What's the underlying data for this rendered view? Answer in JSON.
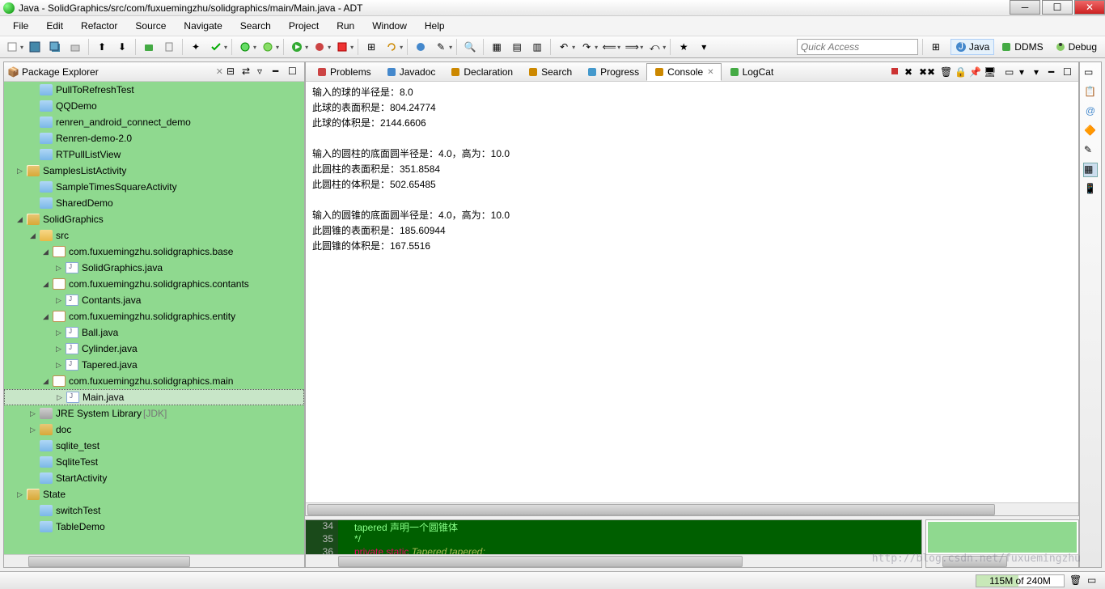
{
  "title": "Java - SolidGraphics/src/com/fuxuemingzhu/solidgraphics/main/Main.java - ADT",
  "menu": [
    "File",
    "Edit",
    "Refactor",
    "Source",
    "Navigate",
    "Search",
    "Project",
    "Run",
    "Window",
    "Help"
  ],
  "quick_access_placeholder": "Quick Access",
  "perspectives": [
    {
      "label": "Java",
      "icon": "java-persp"
    },
    {
      "label": "DDMS",
      "icon": "ddms"
    },
    {
      "label": "Debug",
      "icon": "debug"
    }
  ],
  "package_explorer": {
    "title": "Package Explorer",
    "items": [
      {
        "indent": 2,
        "twisty": "",
        "icon": "folder",
        "label": "PullToRefreshTest"
      },
      {
        "indent": 2,
        "twisty": "",
        "icon": "folder",
        "label": "QQDemo"
      },
      {
        "indent": 2,
        "twisty": "",
        "icon": "folder",
        "label": "renren_android_connect_demo"
      },
      {
        "indent": 2,
        "twisty": "",
        "icon": "folder",
        "label": "Renren-demo-2.0"
      },
      {
        "indent": 2,
        "twisty": "",
        "icon": "folder",
        "label": "RTPullListView"
      },
      {
        "indent": 1,
        "twisty": "▷",
        "icon": "proj",
        "label": "SamplesListActivity"
      },
      {
        "indent": 2,
        "twisty": "",
        "icon": "folder",
        "label": "SampleTimesSquareActivity"
      },
      {
        "indent": 2,
        "twisty": "",
        "icon": "folder",
        "label": "SharedDemo"
      },
      {
        "indent": 1,
        "twisty": "◢",
        "icon": "proj",
        "label": "SolidGraphics"
      },
      {
        "indent": 2,
        "twisty": "◢",
        "icon": "src",
        "label": "src"
      },
      {
        "indent": 3,
        "twisty": "◢",
        "icon": "pkg",
        "label": "com.fuxuemingzhu.solidgraphics.base"
      },
      {
        "indent": 4,
        "twisty": "▷",
        "icon": "java",
        "label": "SolidGraphics.java"
      },
      {
        "indent": 3,
        "twisty": "◢",
        "icon": "pkg",
        "label": "com.fuxuemingzhu.solidgraphics.contants"
      },
      {
        "indent": 4,
        "twisty": "▷",
        "icon": "java",
        "label": "Contants.java"
      },
      {
        "indent": 3,
        "twisty": "◢",
        "icon": "pkg",
        "label": "com.fuxuemingzhu.solidgraphics.entity"
      },
      {
        "indent": 4,
        "twisty": "▷",
        "icon": "java",
        "label": "Ball.java"
      },
      {
        "indent": 4,
        "twisty": "▷",
        "icon": "java",
        "label": "Cylinder.java"
      },
      {
        "indent": 4,
        "twisty": "▷",
        "icon": "java",
        "label": "Tapered.java"
      },
      {
        "indent": 3,
        "twisty": "◢",
        "icon": "pkg",
        "label": "com.fuxuemingzhu.solidgraphics.main"
      },
      {
        "indent": 4,
        "twisty": "▷",
        "icon": "java",
        "label": "Main.java",
        "selected": true
      },
      {
        "indent": 2,
        "twisty": "▷",
        "icon": "lib",
        "label": "JRE System Library",
        "suffix": "[JDK]"
      },
      {
        "indent": 2,
        "twisty": "▷",
        "icon": "folder-open",
        "label": "doc"
      },
      {
        "indent": 2,
        "twisty": "",
        "icon": "folder",
        "label": "sqlite_test"
      },
      {
        "indent": 2,
        "twisty": "",
        "icon": "folder",
        "label": "SqliteTest"
      },
      {
        "indent": 2,
        "twisty": "",
        "icon": "folder",
        "label": "StartActivity"
      },
      {
        "indent": 1,
        "twisty": "▷",
        "icon": "proj",
        "label": "State"
      },
      {
        "indent": 2,
        "twisty": "",
        "icon": "folder",
        "label": "switchTest"
      },
      {
        "indent": 2,
        "twisty": "",
        "icon": "folder",
        "label": "TableDemo"
      }
    ]
  },
  "tabs": [
    {
      "label": "Problems",
      "icon": "problems"
    },
    {
      "label": "Javadoc",
      "icon": "javadoc"
    },
    {
      "label": "Declaration",
      "icon": "declaration"
    },
    {
      "label": "Search",
      "icon": "search"
    },
    {
      "label": "Progress",
      "icon": "progress"
    },
    {
      "label": "Console",
      "icon": "console",
      "active": true,
      "closable": true
    },
    {
      "label": "LogCat",
      "icon": "logcat"
    }
  ],
  "console_output": [
    "输入的球的半径是：8.0",
    "此球的表面积是：804.24774",
    "此球的体积是：2144.6606",
    "",
    "输入的圆柱的底面圆半径是：4.0，高为：10.0",
    "此圆柱的表面积是：351.8584",
    "此圆柱的体积是：502.65485",
    "",
    "输入的圆锥的底面圆半径是：4.0，高为：10.0",
    "此圆锥的表面积是：185.60944",
    "此圆锥的体积是：167.5516"
  ],
  "code_snippet": [
    {
      "num": "34",
      "tokens": [
        {
          "t": "         tapered  声明一个圆锥体",
          "c": "cmt"
        }
      ]
    },
    {
      "num": "35",
      "tokens": [
        {
          "t": "     */",
          "c": "cmt"
        }
      ]
    },
    {
      "num": "36",
      "tokens": [
        {
          "t": "    private static ",
          "c": "kw"
        },
        {
          "t": "Tapered ",
          "c": "cls"
        },
        {
          "t": "tapered;",
          "c": "cls"
        }
      ]
    }
  ],
  "heap": {
    "used": "115M",
    "total": "240M",
    "percent": 48
  },
  "watermark": "http://blog.csdn.net/fuxuemingzhu"
}
